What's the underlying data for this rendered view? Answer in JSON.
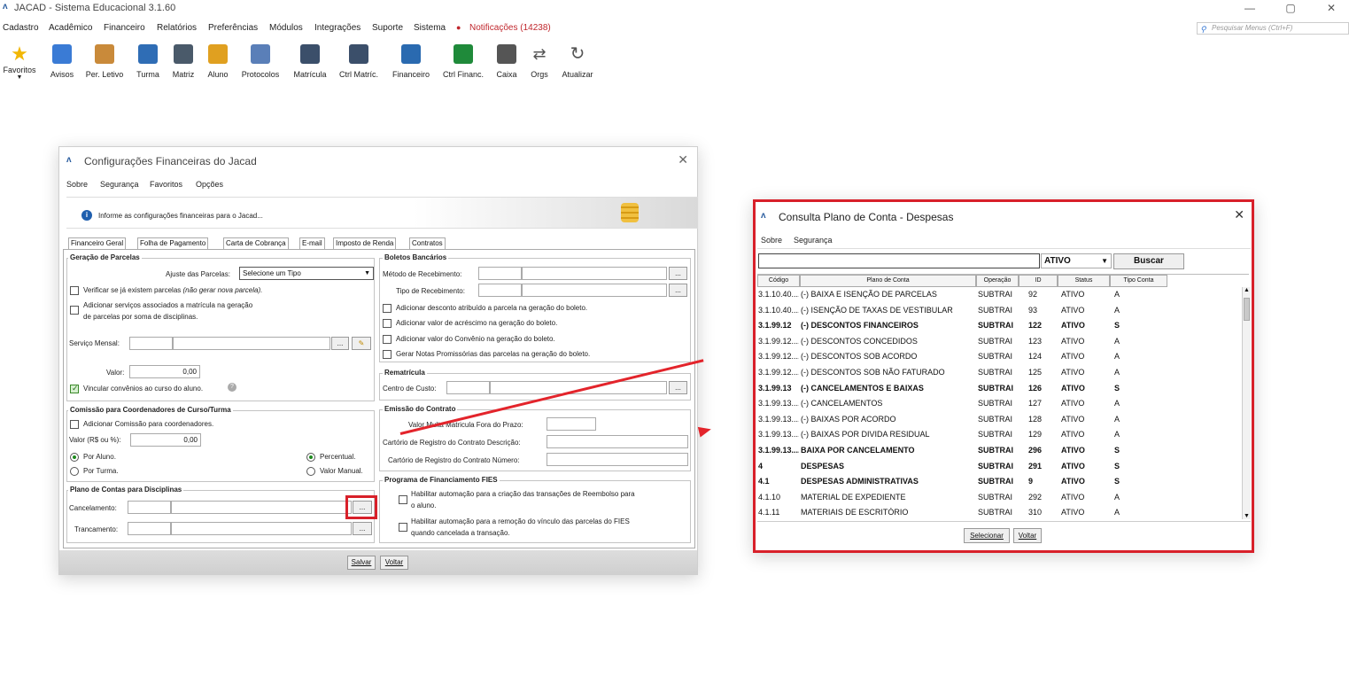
{
  "app": {
    "title": "JACAD - Sistema Educacional 3.1.60",
    "logo": "ʌ",
    "win_min": "—",
    "win_max": "▢",
    "win_close": "✕"
  },
  "menubar": [
    {
      "label": "Cadastro"
    },
    {
      "label": "Acadêmico"
    },
    {
      "label": "Financeiro"
    },
    {
      "label": "Relatórios"
    },
    {
      "label": "Preferências"
    },
    {
      "label": "Módulos"
    },
    {
      "label": "Integrações"
    },
    {
      "label": "Suporte"
    },
    {
      "label": "Sistema"
    },
    {
      "label": "Notificações (14238)"
    }
  ],
  "search": {
    "placeholder": "Pesquisar Menus (Ctrl+F)"
  },
  "toolbar": [
    {
      "label": "Favoritos",
      "icon": "star-icon",
      "color": "#f2b705"
    },
    {
      "label": "Avisos",
      "icon": "envelope-icon",
      "color": "#3a7bd5"
    },
    {
      "label": "Per. Letivo",
      "icon": "calendar-icon",
      "color": "#c98a3a"
    },
    {
      "label": "Turma",
      "icon": "classroom-icon",
      "color": "#2f6db5"
    },
    {
      "label": "Matriz",
      "icon": "matrix-icon",
      "color": "#4a5a6a"
    },
    {
      "label": "Aluno",
      "icon": "graduate-icon",
      "color": "#e0a020"
    },
    {
      "label": "Protocolos",
      "icon": "protocol-icon",
      "color": "#5a7fb8"
    },
    {
      "label": "Matrícula",
      "icon": "edit-form-icon",
      "color": "#3b4f6a"
    },
    {
      "label": "Ctrl Matríc.",
      "icon": "document-search-icon",
      "color": "#3b4f6a"
    },
    {
      "label": "Financeiro",
      "icon": "user-money-icon",
      "color": "#2a6ab0"
    },
    {
      "label": "Ctrl Financ.",
      "icon": "money-hand-icon",
      "color": "#1f8a3a"
    },
    {
      "label": "Caixa",
      "icon": "cash-register-icon",
      "color": "#555555"
    },
    {
      "label": "Orgs",
      "icon": "swap-arrows-icon",
      "color": "#555555"
    },
    {
      "label": "Atualizar",
      "icon": "refresh-icon",
      "color": "#555555"
    }
  ],
  "cfg": {
    "title": "Configurações Financeiras do Jacad",
    "close": "✕",
    "menu": [
      "Sobre",
      "Segurança",
      "Favoritos",
      "Opções"
    ],
    "info": "Informe as configurações financeiras para o Jacad...",
    "info_icon": "i",
    "tabs": [
      "Financeiro Geral",
      "Folha de Pagamento",
      "Carta de Cobrança",
      "E-mail",
      "Imposto de Renda",
      "Contratos"
    ],
    "geracao": {
      "title": "Geração de Parcelas",
      "ajuste_label": "Ajuste das Parcelas:",
      "ajuste_value": "Selecione um Tipo",
      "verificar_main": "Verificar se já existem parcelas ",
      "verificar_em": "(não gerar nova parcela).",
      "adicionar_l1": "Adicionar serviços associados a matrícula na geração",
      "adicionar_l2": "de parcelas por soma de disciplinas.",
      "servico_label": "Serviço Mensal:",
      "valor_label": "Valor:",
      "valor_value": "0,00",
      "vincular": "Vincular convênios ao curso do aluno."
    },
    "comissao": {
      "title": "Comissão para Coordenadores de Curso/Turma",
      "adicionar": "Adicionar Comissão para coordenadores.",
      "valor_label": "Valor (R$ ou %):",
      "valor_value": "0,00",
      "por_aluno": "Por Aluno.",
      "por_turma": "Por Turma.",
      "percentual": "Percentual.",
      "manual": "Valor Manual."
    },
    "plano": {
      "title": "Plano de Contas para Disciplinas",
      "cancelamento": "Cancelamento:",
      "trancamento": "Trancamento:"
    },
    "boletos": {
      "title": "Boletos Bancários",
      "metodo": "Método de Recebimento:",
      "tipo": "Tipo de Recebimento:",
      "c1": "Adicionar desconto atribuído a parcela na geração do boleto.",
      "c2": "Adicionar valor de acréscimo na geração do boleto.",
      "c3": "Adicionar valor do Convênio na geração do boleto.",
      "c4": "Gerar Notas Promissórias das parcelas na geração do boleto."
    },
    "rematricula": {
      "title": "Rematrícula",
      "centro": "Centro de Custo:"
    },
    "emissao": {
      "title": "Emissão do Contrato",
      "multa": "Valor Multa Matricula Fora do Prazo:",
      "cartorio_desc": "Cartório de Registro do Contrato Descrição:",
      "cartorio_num": "Cartório de Registro do Contrato Número:"
    },
    "fies": {
      "title": "Programa de Financiamento FIES",
      "h1_l1": "Habilitar automação para a criação das transações de Reembolso para",
      "h1_l2": "o aluno.",
      "h2_l1": "Habilitar automação para a remoção do vínculo das parcelas do FIES",
      "h2_l2": "quando cancelada a transação."
    },
    "ellipsis": "...",
    "pencil": "✎",
    "dropdown_arrow": "▼",
    "help": "?",
    "salvar": "Salvar",
    "voltar": "Voltar"
  },
  "cons": {
    "title": "Consulta Plano de Conta - Despesas",
    "close": "✕",
    "menu": [
      "Sobre",
      "Segurança"
    ],
    "status_value": "ATIVO",
    "buscar": "Buscar",
    "dropdown_arrow": "▼",
    "scroll_up": "▲",
    "scroll_down": "▼",
    "columns": [
      "Código",
      "Plano de Conta",
      "Operação",
      "ID",
      "Status",
      "Tipo Conta"
    ],
    "rows": [
      {
        "codigo": "3.1.10.40....",
        "plano": "(-) BAIXA E ISENÇÃO DE PARCELAS",
        "op": "SUBTRAI",
        "id": "92",
        "status": "ATIVO",
        "tipo": "A",
        "bold": false
      },
      {
        "codigo": "3.1.10.40....",
        "plano": "(-) ISENÇÃO DE TAXAS DE VESTIBULAR",
        "op": "SUBTRAI",
        "id": "93",
        "status": "ATIVO",
        "tipo": "A",
        "bold": false
      },
      {
        "codigo": "3.1.99.12",
        "plano": "(-) DESCONTOS FINANCEIROS",
        "op": "SUBTRAI",
        "id": "122",
        "status": "ATIVO",
        "tipo": "S",
        "bold": true
      },
      {
        "codigo": "3.1.99.12....",
        "plano": "(-) DESCONTOS CONCEDIDOS",
        "op": "SUBTRAI",
        "id": "123",
        "status": "ATIVO",
        "tipo": "A",
        "bold": false
      },
      {
        "codigo": "3.1.99.12....",
        "plano": "(-) DESCONTOS SOB ACORDO",
        "op": "SUBTRAI",
        "id": "124",
        "status": "ATIVO",
        "tipo": "A",
        "bold": false
      },
      {
        "codigo": "3.1.99.12....",
        "plano": "(-) DESCONTOS SOB NÃO FATURADO",
        "op": "SUBTRAI",
        "id": "125",
        "status": "ATIVO",
        "tipo": "A",
        "bold": false
      },
      {
        "codigo": "3.1.99.13",
        "plano": "(-) CANCELAMENTOS E BAIXAS",
        "op": "SUBTRAI",
        "id": "126",
        "status": "ATIVO",
        "tipo": "S",
        "bold": true
      },
      {
        "codigo": "3.1.99.13....",
        "plano": "(-) CANCELAMENTOS",
        "op": "SUBTRAI",
        "id": "127",
        "status": "ATIVO",
        "tipo": "A",
        "bold": false
      },
      {
        "codigo": "3.1.99.13....",
        "plano": "(-) BAIXAS POR ACORDO",
        "op": "SUBTRAI",
        "id": "128",
        "status": "ATIVO",
        "tipo": "A",
        "bold": false
      },
      {
        "codigo": "3.1.99.13....",
        "plano": "(-) BAIXAS POR DIVIDA RESIDUAL",
        "op": "SUBTRAI",
        "id": "129",
        "status": "ATIVO",
        "tipo": "A",
        "bold": false
      },
      {
        "codigo": "3.1.99.13....",
        "plano": "BAIXA POR CANCELAMENTO",
        "op": "SUBTRAI",
        "id": "296",
        "status": "ATIVO",
        "tipo": "S",
        "bold": true
      },
      {
        "codigo": "4",
        "plano": "DESPESAS",
        "op": "SUBTRAI",
        "id": "291",
        "status": "ATIVO",
        "tipo": "S",
        "bold": true
      },
      {
        "codigo": "4.1",
        "plano": "DESPESAS ADMINISTRATIVAS",
        "op": "SUBTRAI",
        "id": "9",
        "status": "ATIVO",
        "tipo": "S",
        "bold": true
      },
      {
        "codigo": "4.1.10",
        "plano": "MATERIAL DE EXPEDIENTE",
        "op": "SUBTRAI",
        "id": "292",
        "status": "ATIVO",
        "tipo": "A",
        "bold": false
      },
      {
        "codigo": "4.1.11",
        "plano": "MATERIAIS DE ESCRITÓRIO",
        "op": "SUBTRAI",
        "id": "310",
        "status": "ATIVO",
        "tipo": "A",
        "bold": false
      }
    ],
    "selecionar": "Selecionar",
    "voltar": "Voltar"
  },
  "colors": {
    "accent_red": "#d8202a",
    "notif_red": "#c0272d",
    "brand_blue": "#2a5d9f"
  }
}
